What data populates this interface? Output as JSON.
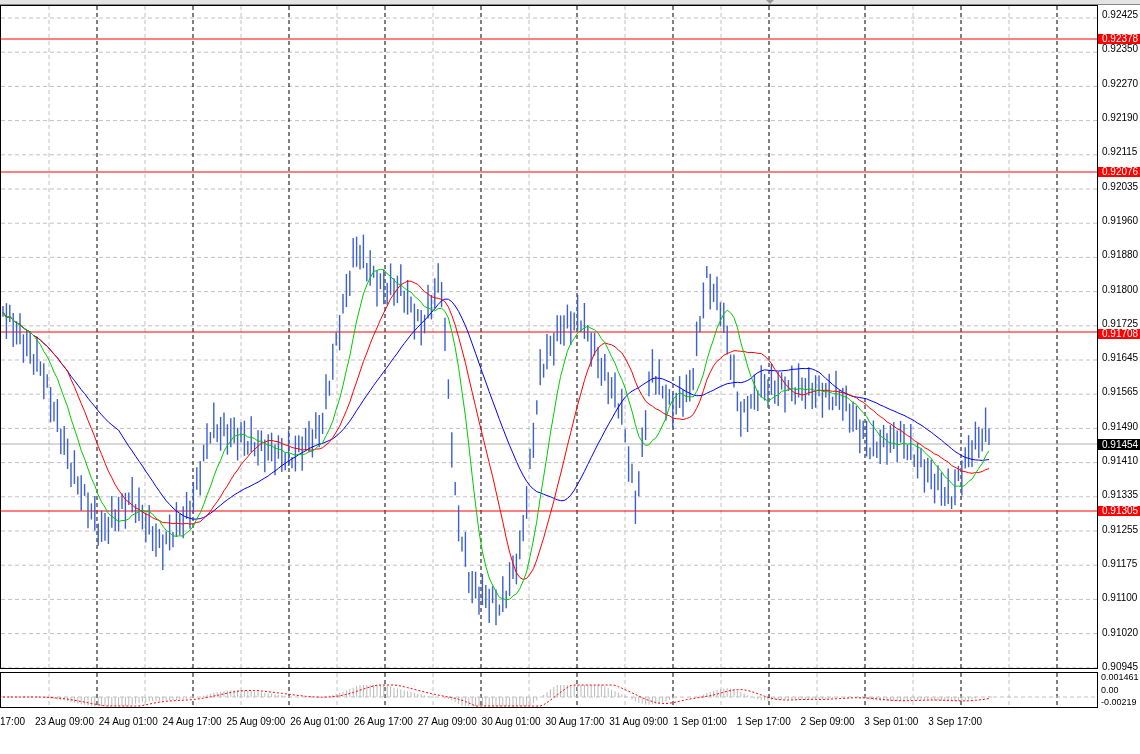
{
  "price_axis": {
    "ticks": [
      "0.92425",
      "0.92350",
      "0.92270",
      "0.92190",
      "0.92115",
      "0.92035",
      "0.91960",
      "0.91880",
      "0.91800",
      "0.91725",
      "0.91645",
      "0.91565",
      "0.91490",
      "0.91410",
      "0.91335",
      "0.91255",
      "0.91175",
      "0.91100",
      "0.91020",
      "0.90945"
    ]
  },
  "price_lines": [
    {
      "label": "0.92378"
    },
    {
      "label": "0.92076"
    },
    {
      "label": "0.91708"
    },
    {
      "label": "0.91305"
    }
  ],
  "current_price": {
    "label": "0.91454"
  },
  "indicator_axis": {
    "ticks": [
      "0.001461",
      "0.00",
      "-0.00219"
    ]
  },
  "time_axis": {
    "labels": [
      "17:00",
      "23 Aug 09:00",
      "24 Aug 01:00",
      "24 Aug 17:00",
      "25 Aug 09:00",
      "26 Aug 01:00",
      "26 Aug 17:00",
      "27 Aug 09:00",
      "30 Aug 01:00",
      "30 Aug 17:00",
      "31 Aug 09:00",
      "1 Sep 01:00",
      "1 Sep 17:00",
      "2 Sep 09:00",
      "3 Sep 01:00",
      "3 Sep 17:00"
    ]
  }
}
